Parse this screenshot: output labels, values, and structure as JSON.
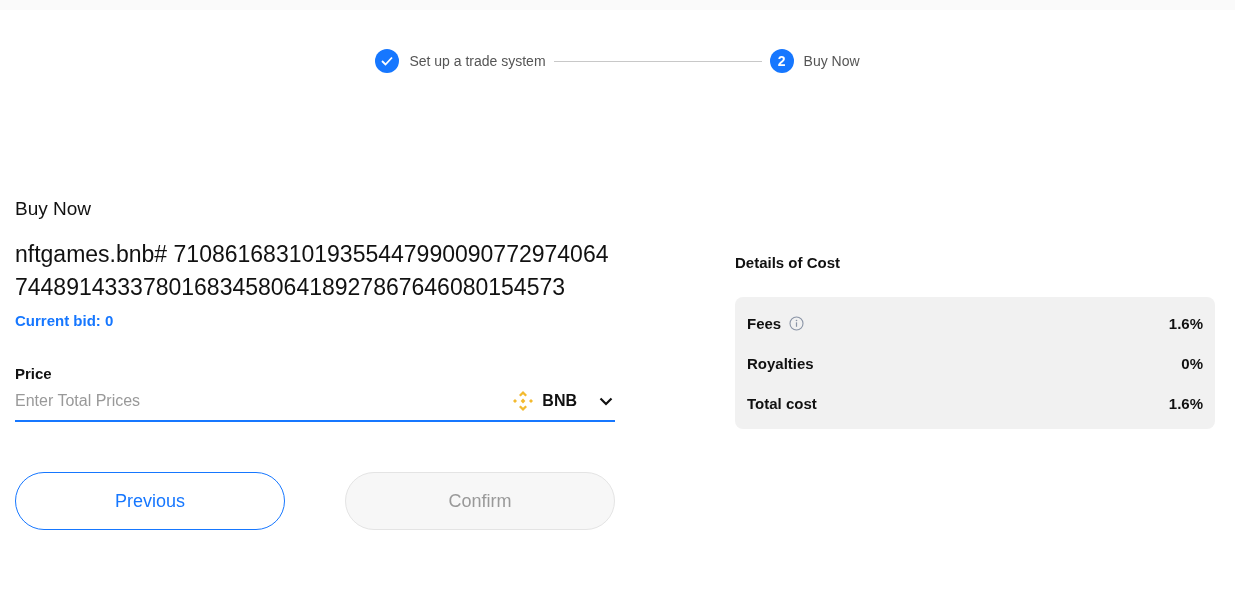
{
  "steps": [
    {
      "label": "Set up a trade system",
      "done": true
    },
    {
      "label": "Buy Now",
      "done": false,
      "number": "2"
    }
  ],
  "heading": "Buy Now",
  "item_name": "nftgames.bnb# 71086168310193554479900907729740647448914333780168345806418927867646080154573",
  "current_bid": "Current bid: 0",
  "price": {
    "label": "Price",
    "placeholder": "Enter Total Prices",
    "currency": "BNB"
  },
  "buttons": [
    {
      "label": "Previous",
      "disabled": false
    },
    {
      "label": "Confirm",
      "disabled": true
    }
  ],
  "cost": {
    "title": "Details of Cost",
    "rows": [
      {
        "label": "Fees",
        "value": "1.6%",
        "info": true
      },
      {
        "label": "Royalties",
        "value": "0%",
        "info": false
      },
      {
        "label": "Total cost",
        "value": "1.6%",
        "info": false
      }
    ]
  }
}
